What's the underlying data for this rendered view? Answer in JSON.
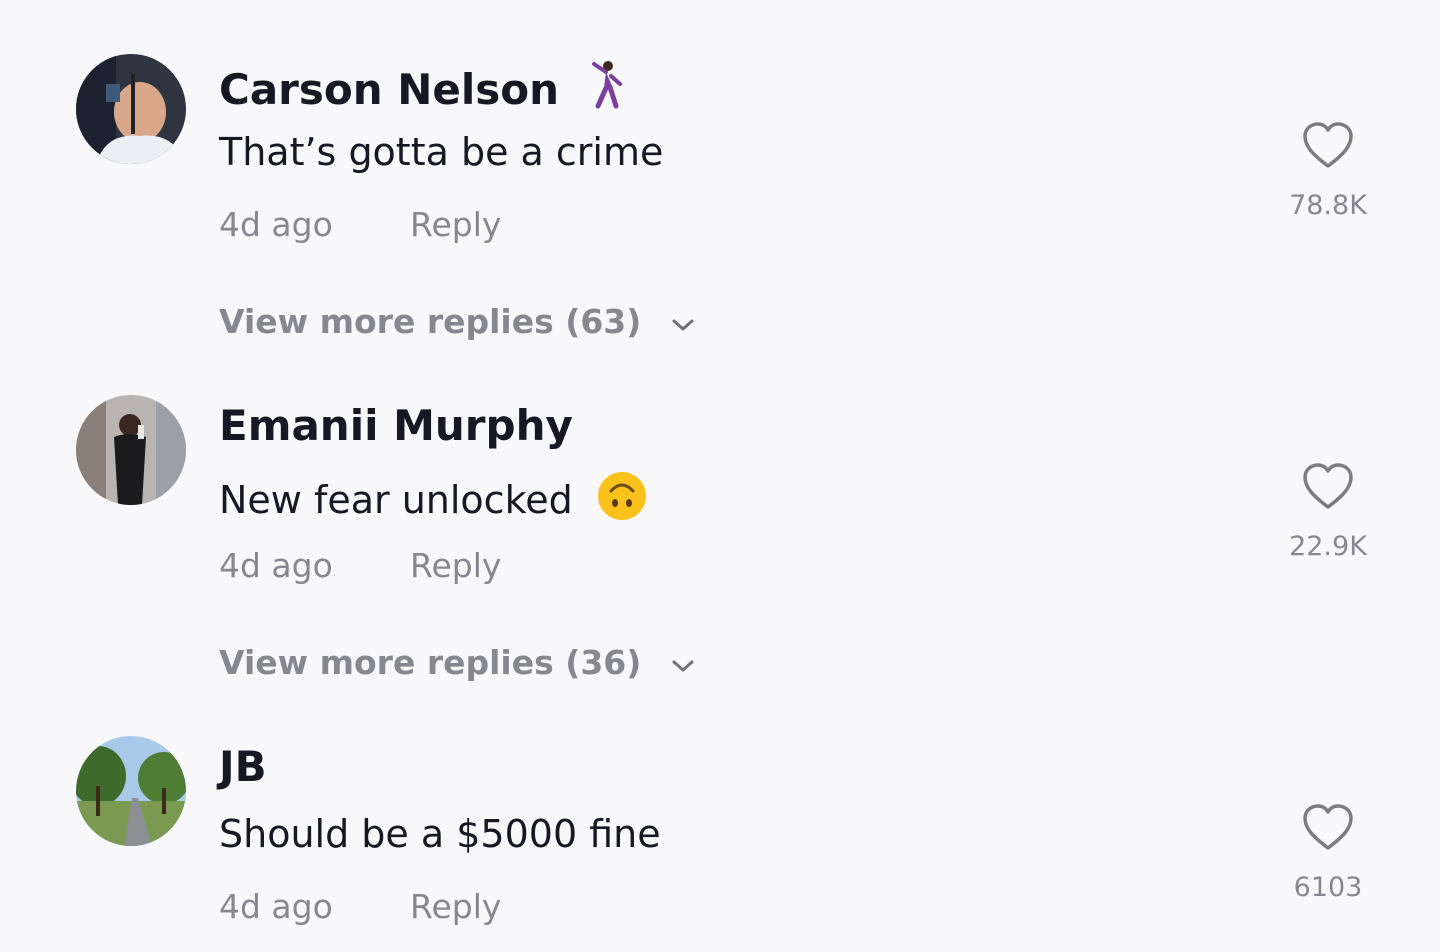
{
  "comments": [
    {
      "username": "Carson Nelson",
      "username_emoji": "dancing-man-emoji",
      "text": "That’s gotta be a crime",
      "text_emoji": "",
      "time": "4d ago",
      "reply_label": "Reply",
      "likes": "78.8K",
      "view_more": "View more replies (63)",
      "avatar": "man-in-white-hoodie-avatar"
    },
    {
      "username": "Emanii Murphy",
      "username_emoji": "",
      "text": "New fear unlocked",
      "text_emoji": "upside-down-face-emoji",
      "time": "4d ago",
      "reply_label": "Reply",
      "likes": "22.9K",
      "view_more": "View more replies (36)",
      "avatar": "person-mirror-selfie-avatar"
    },
    {
      "username": "JB",
      "username_emoji": "",
      "text": "Should be a $5000 fine",
      "text_emoji": "",
      "time": "4d ago",
      "reply_label": "Reply",
      "likes": "6103",
      "view_more": "",
      "avatar": "tree-lined-road-avatar"
    }
  ],
  "colors": {
    "background": "#f8f8fa",
    "primary_text": "#161823",
    "secondary_text": "rgba(22,24,35,0.5)",
    "emoji_yellow": "#fcc21b",
    "emoji_purple": "#7b3fa0"
  }
}
